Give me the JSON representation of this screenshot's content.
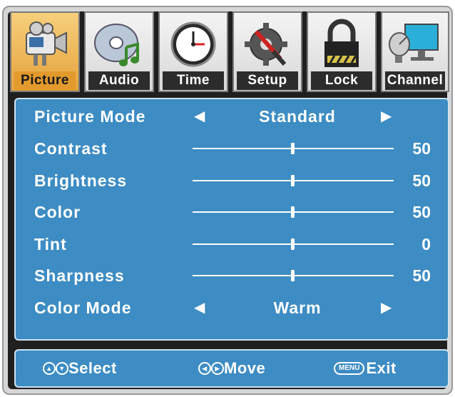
{
  "tabs": [
    {
      "label": "Picture",
      "icon": "camera-icon",
      "active": true
    },
    {
      "label": "Audio",
      "icon": "music-disc-icon",
      "active": false
    },
    {
      "label": "Time",
      "icon": "clock-icon",
      "active": false
    },
    {
      "label": "Setup",
      "icon": "gear-wrench-icon",
      "active": false
    },
    {
      "label": "Lock",
      "icon": "padlock-icon",
      "active": false
    },
    {
      "label": "Channel",
      "icon": "satellite-monitor-icon",
      "active": false
    }
  ],
  "picture": {
    "mode": {
      "label": "Picture Mode",
      "value": "Standard"
    },
    "contrast": {
      "label": "Contrast",
      "value": "50",
      "level": 0.5
    },
    "brightness": {
      "label": "Brightness",
      "value": "50",
      "level": 0.5
    },
    "color": {
      "label": "Color",
      "value": "50",
      "level": 0.5
    },
    "tint": {
      "label": "Tint",
      "value": "0",
      "level": 0.5
    },
    "sharpness": {
      "label": "Sharpness",
      "value": "50",
      "level": 0.5
    },
    "color_mode": {
      "label": "Color Mode",
      "value": "Warm"
    }
  },
  "footer": {
    "select": "Select",
    "move": "Move",
    "menu_key": "MENU",
    "exit": "Exit"
  },
  "colors": {
    "panel": "#3d8cc3",
    "active_tab": "#e6a23c",
    "text": "#ffffff"
  }
}
